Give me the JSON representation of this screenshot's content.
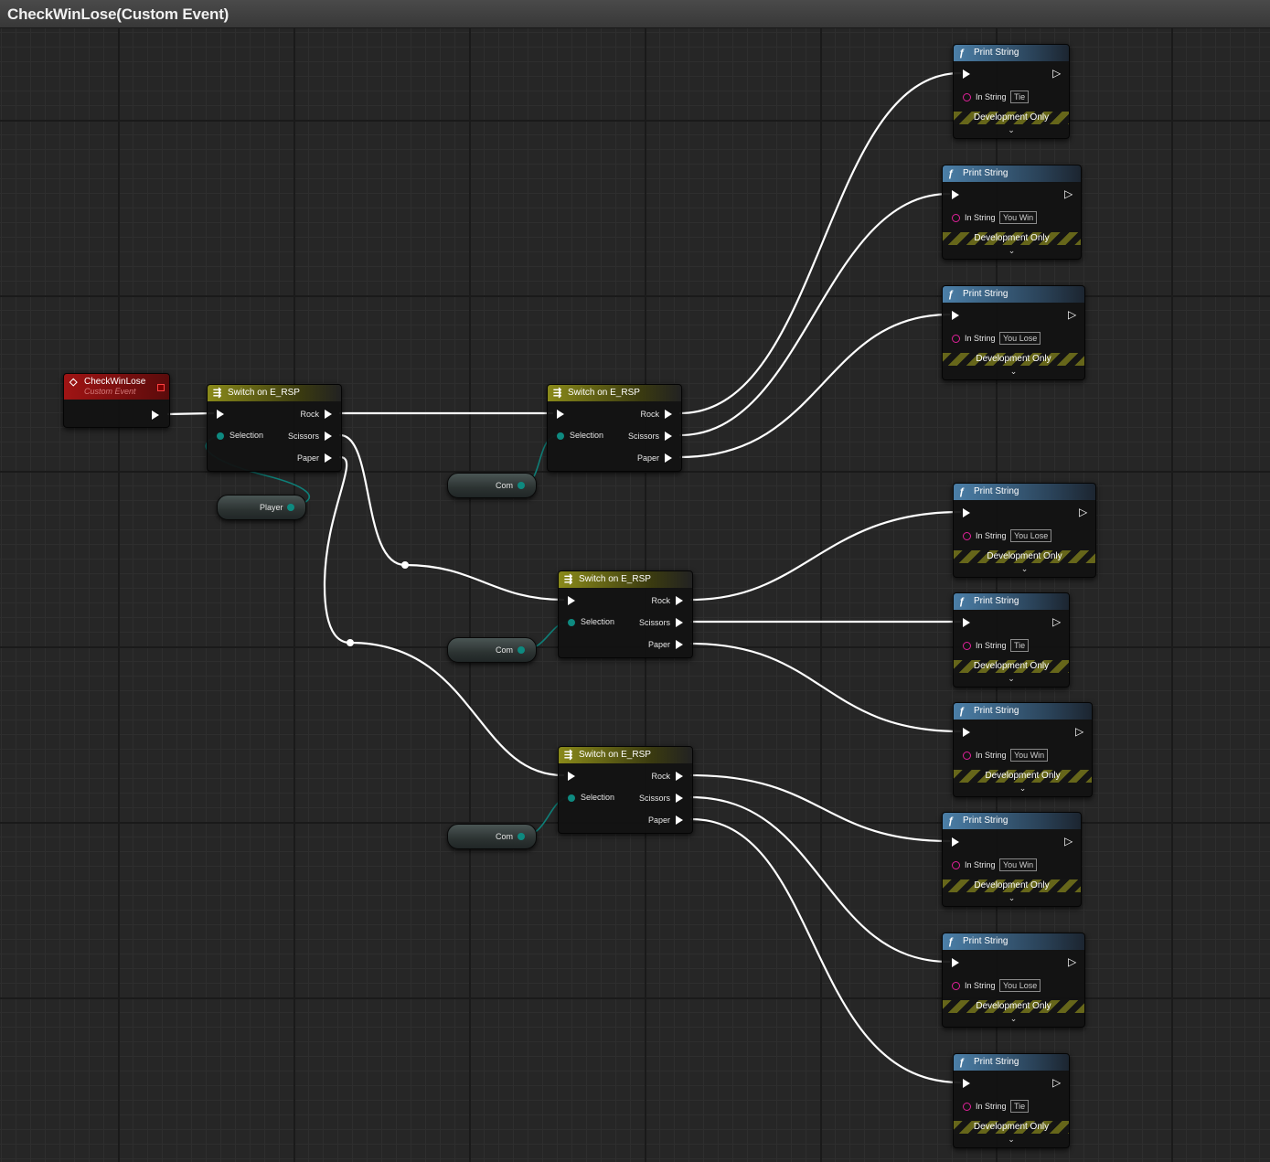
{
  "title": "CheckWinLose(Custom Event)",
  "event": {
    "name": "CheckWinLose",
    "subtitle": "Custom Event",
    "icon": "event-diamond-icon"
  },
  "switch_title": "Switch on E_RSP",
  "switch_pins": {
    "selection": "Selection",
    "rock": "Rock",
    "scissors": "Scissors",
    "paper": "Paper"
  },
  "variables": {
    "player": "Player",
    "com": "Com"
  },
  "print": {
    "title": "Print String",
    "in_string_label": "In String",
    "dev_label": "Development Only",
    "icon": "function-icon"
  },
  "print_values": [
    "Tie",
    "You Win",
    "You Lose",
    "You Lose",
    "Tie",
    "You Win",
    "You Win",
    "You Lose",
    "Tie"
  ],
  "colors": {
    "exec_wire": "#ffffff",
    "enum_wire": "#0e7f78",
    "string_pin": "#e0209a",
    "event_header": "#a01414",
    "switch_header": "#8a8a1a",
    "function_header": "#4b7fa8"
  }
}
